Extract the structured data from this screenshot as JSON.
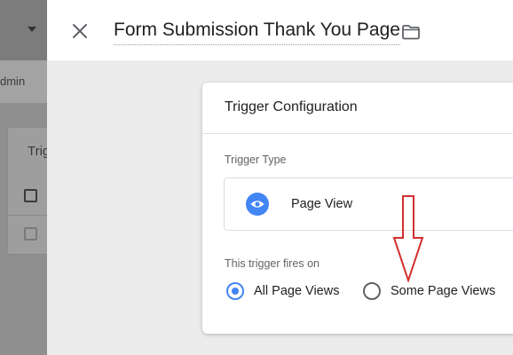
{
  "background": {
    "admin_label": "dmin",
    "trigger_heading": "Trig"
  },
  "header": {
    "title": "Form Submission Thank You Page",
    "close_icon": "close-icon",
    "folder_icon": "folder-icon"
  },
  "trigger_config": {
    "title": "Trigger Configuration",
    "type_label": "Trigger Type",
    "type_name": "Page View",
    "type_icon": "eye-icon",
    "fires_on_label": "This trigger fires on",
    "options": [
      {
        "label": "All Page Views",
        "selected": true
      },
      {
        "label": "Some Page Views",
        "selected": false
      }
    ]
  },
  "annotation": {
    "arrow_color": "#d32f2f",
    "arrow_direction": "down"
  },
  "colors": {
    "accent": "#4285f4",
    "annotation": "#d32f2f"
  }
}
